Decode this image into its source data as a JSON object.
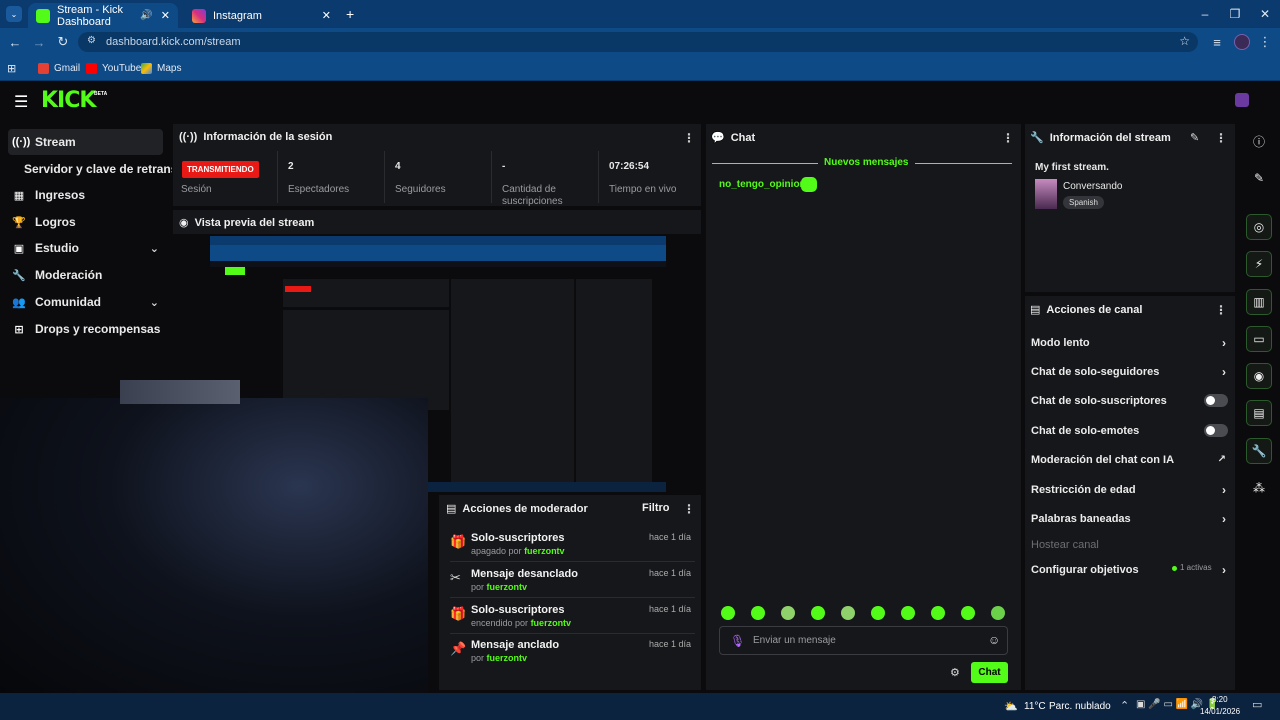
{
  "browser": {
    "tabs": [
      {
        "title": "Stream - Kick Dashboard",
        "active": true
      },
      {
        "title": "Instagram",
        "active": false
      }
    ],
    "url": "dashboard.kick.com/stream",
    "bookmarks": [
      "Gmail",
      "YouTube",
      "Maps"
    ],
    "new_tab": "+",
    "window_controls": [
      "–",
      "❐",
      "✕"
    ]
  },
  "header": {
    "logo": "KICK",
    "beta": "BETA"
  },
  "sidebar": {
    "items": [
      {
        "label": "Stream",
        "icon": "broadcast-icon",
        "active": true
      },
      {
        "label": "Servidor y clave de retransmisión",
        "icon": "",
        "sub": true
      },
      {
        "label": "Ingresos",
        "icon": "chart-icon"
      },
      {
        "label": "Logros",
        "icon": "trophy-icon"
      },
      {
        "label": "Estudio",
        "icon": "studio-icon",
        "expand": true
      },
      {
        "label": "Moderación",
        "icon": "wrench-icon"
      },
      {
        "label": "Comunidad",
        "icon": "community-icon",
        "expand": true
      },
      {
        "label": "Drops y recompensas",
        "icon": "gift-icon"
      }
    ]
  },
  "session": {
    "title": "Información de la sesión",
    "status_badge": "TRANSMITIENDO",
    "stats": [
      {
        "value": "",
        "label": "Sesión"
      },
      {
        "value": "2",
        "label": "Espectadores"
      },
      {
        "value": "4",
        "label": "Seguidores"
      },
      {
        "value": "-",
        "label": "Cantidad de suscripciones"
      },
      {
        "value": "07:26:54",
        "label": "Tiempo en vivo"
      }
    ]
  },
  "preview": {
    "title": "Vista previa del stream"
  },
  "moderator": {
    "title": "Acciones de moderador",
    "filter": "Filtro",
    "actions": [
      {
        "title": "Solo-suscriptores",
        "sub": "apagado por",
        "user": "fuerzontv",
        "ago": "hace 1 día",
        "icon": "gift-icon"
      },
      {
        "title": "Mensaje desanclado",
        "sub": "por",
        "user": "fuerzontv",
        "ago": "hace 1 día",
        "icon": "unpin-icon"
      },
      {
        "title": "Solo-suscriptores",
        "sub": "encendido por",
        "user": "fuerzontv",
        "ago": "hace 1 día",
        "icon": "gift-icon"
      },
      {
        "title": "Mensaje anclado",
        "sub": "por",
        "user": "fuerzontv",
        "ago": "hace 1 día",
        "icon": "pin-icon"
      }
    ]
  },
  "chat": {
    "title": "Chat",
    "new_messages": "Nuevos mensajes",
    "messages": [
      {
        "user": "no_tengo_opinion",
        "sep": ":"
      }
    ],
    "placeholder": "Enviar un mensaje",
    "send": "Chat"
  },
  "stream_info": {
    "title": "Información del stream",
    "stream_title": "My first stream.",
    "category": "Conversando",
    "language": "Spanish"
  },
  "channel_actions": {
    "title": "Acciones de canal",
    "items": [
      {
        "label": "Modo lento",
        "type": "arrow"
      },
      {
        "label": "Chat de solo-seguidores",
        "type": "arrow"
      },
      {
        "label": "Chat de solo-suscriptores",
        "type": "toggle"
      },
      {
        "label": "Chat de solo-emotes",
        "type": "toggle"
      },
      {
        "label": "Moderación del chat con IA",
        "type": "external"
      },
      {
        "label": "Restricción de edad",
        "type": "arrow"
      },
      {
        "label": "Palabras baneadas",
        "type": "arrow"
      },
      {
        "label": "Hostear canal",
        "type": "disabled"
      },
      {
        "label": "Configurar objetivos",
        "type": "arrow",
        "badge": "1 activas"
      }
    ]
  },
  "taskbar": {
    "weather_temp": "11°C",
    "weather_text": "Parc. nublado",
    "time": "8:20",
    "date": "14/01/2026"
  },
  "colors": {
    "accent": "#53fc18",
    "live_badge": "#e91916",
    "panel": "#16171a",
    "bg": "#0b0b0d"
  }
}
